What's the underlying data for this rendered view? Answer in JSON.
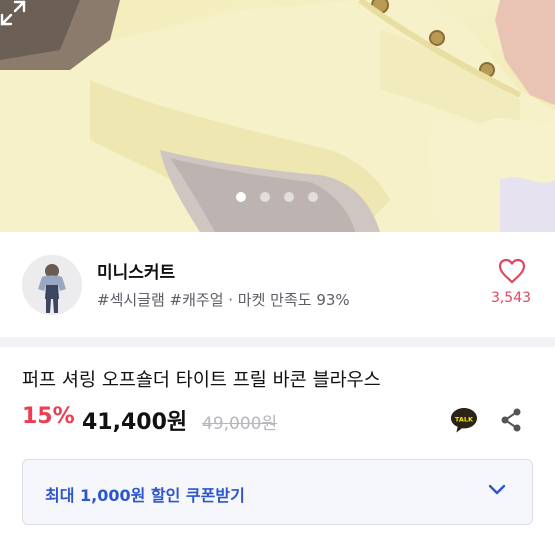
{
  "gallery": {
    "dot_count": 4,
    "active_index": 0,
    "expand_icon": "expand-icon"
  },
  "shop": {
    "name": "미니스커트",
    "tags": "#섹시글램 #캐주얼 · 마켓 만족도 93%",
    "like_count": "3,543",
    "avatar_icon": "shop-avatar"
  },
  "product": {
    "title": "퍼프 셔링 오프숄더 타이트 프릴 바콘 블라우스",
    "discount": "15%",
    "price": "41,400원",
    "original_price": "49,000원"
  },
  "actions": {
    "talk_label": "TALK",
    "share_icon": "share-icon"
  },
  "coupon": {
    "label": "최대 1,000원 할인 쿠폰받기"
  },
  "colors": {
    "accent_red": "#ee3d52",
    "coupon_blue": "#2d56c9",
    "talk_yellow": "#fae100"
  }
}
